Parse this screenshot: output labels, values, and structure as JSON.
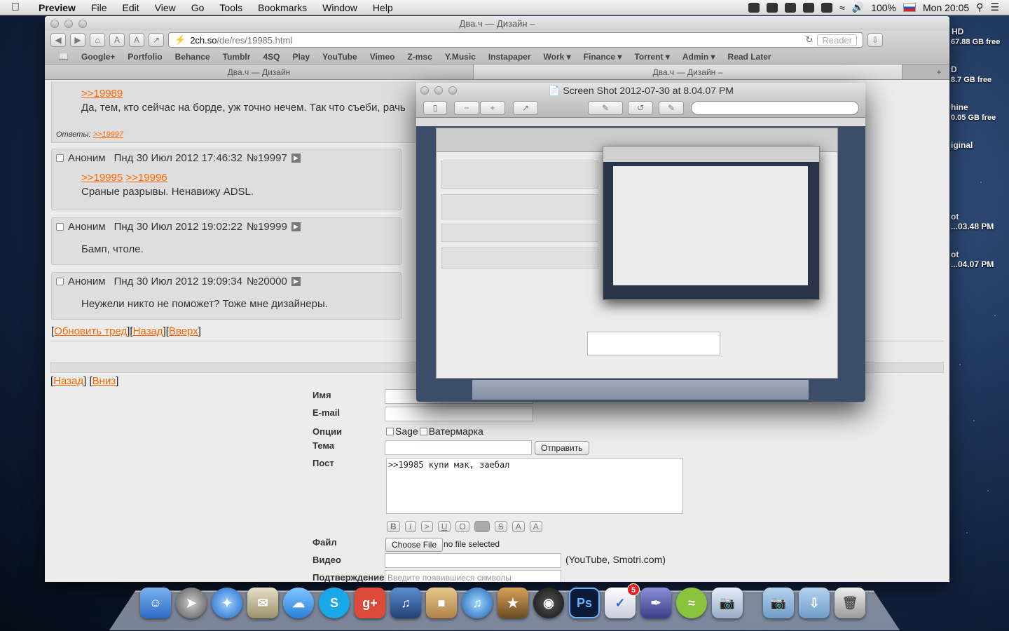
{
  "menubar": {
    "app": "Preview",
    "items": [
      "File",
      "Edit",
      "View",
      "Go",
      "Tools",
      "Bookmarks",
      "Window",
      "Help"
    ],
    "battery": "100%",
    "clock": "Mon 20:05"
  },
  "desktop": {
    "labels": [
      "HD",
      "67.88 GB free",
      "D",
      "8.7 GB free",
      "hine",
      "0.05 GB free",
      "iginal",
      "ot",
      "...03.48 PM",
      "ot",
      "...04.07 PM"
    ]
  },
  "safari": {
    "title": "Два.ч — Дизайн –",
    "url_host": "2ch.so",
    "url_path": "/de/res/19985.html",
    "reader": "Reader",
    "bookmarks": [
      "Google+",
      "Portfolio",
      "Behance",
      "Tumblr",
      "4SQ",
      "Play",
      "YouTube",
      "Vimeo",
      "Z-msc",
      "Y.Music",
      "Instapaper",
      "Work ▾",
      "Finance ▾",
      "Torrent ▾",
      "Admin ▾",
      "Read Later"
    ],
    "tabs": [
      "Два.ч — Дизайн",
      "Два.ч — Дизайн –"
    ],
    "page": {
      "top_post": {
        "reply_link": ">>19989",
        "text": "Да, тем, кто сейчас на борде, уж точно нечем. Так что съеби, рачь",
        "answers_label": "Ответы:",
        "answers_link": ">>19997"
      },
      "posts": [
        {
          "name": "Аноним",
          "date": "Пнд 30 Июл 2012 17:46:32",
          "num": "№19997",
          "links": [
            ">>19995",
            ">>19996"
          ],
          "text": "Сраные разрывы. Ненавижу ADSL."
        },
        {
          "name": "Аноним",
          "date": "Пнд 30 Июл 2012 19:02:22",
          "num": "№19999",
          "links": [],
          "text": "Бамп, чтоле."
        },
        {
          "name": "Аноним",
          "date": "Пнд 30 Июл 2012 19:09:34",
          "num": "№20000",
          "links": [],
          "text": "Неужели никто не поможет? Тоже мне дизайнеры."
        }
      ],
      "thread_nav": {
        "refresh": "Обновить тред",
        "back": "Назад",
        "up": "Вверх"
      },
      "bottom_nav": {
        "back": "Назад",
        "down": "Вниз"
      },
      "form": {
        "name_label": "Имя",
        "email_label": "E-mail",
        "options_label": "Опции",
        "sage": "Sage",
        "watermark": "Ватермарка",
        "subject_label": "Тема",
        "submit": "Отправить",
        "post_label": "Пост",
        "post_value": ">>19985 купи мак, заебал",
        "file_label": "Файл",
        "choose_file": "Choose File",
        "no_file": "no file selected",
        "video_label": "Видео",
        "video_hint": "(YouTube, Smotri.com)",
        "captcha_label": "Подтверждение",
        "captcha_placeholder": "Введите появившиеся символы"
      }
    }
  },
  "preview": {
    "title": "Screen Shot 2012-07-30 at 8.04.07 PM"
  },
  "dock": {
    "apps": [
      "Finder",
      "Launchpad",
      "Safari",
      "Mail",
      "Messages",
      "Skype",
      "Google+",
      "Scrobbler",
      "Delivery",
      "iTunes",
      "iPhoto",
      "Aperture",
      "Photoshop",
      "Things",
      "Pixelmator",
      "Spotify",
      "Preview",
      "Images",
      "Downloads",
      "Trash"
    ],
    "things_badge": "5"
  }
}
